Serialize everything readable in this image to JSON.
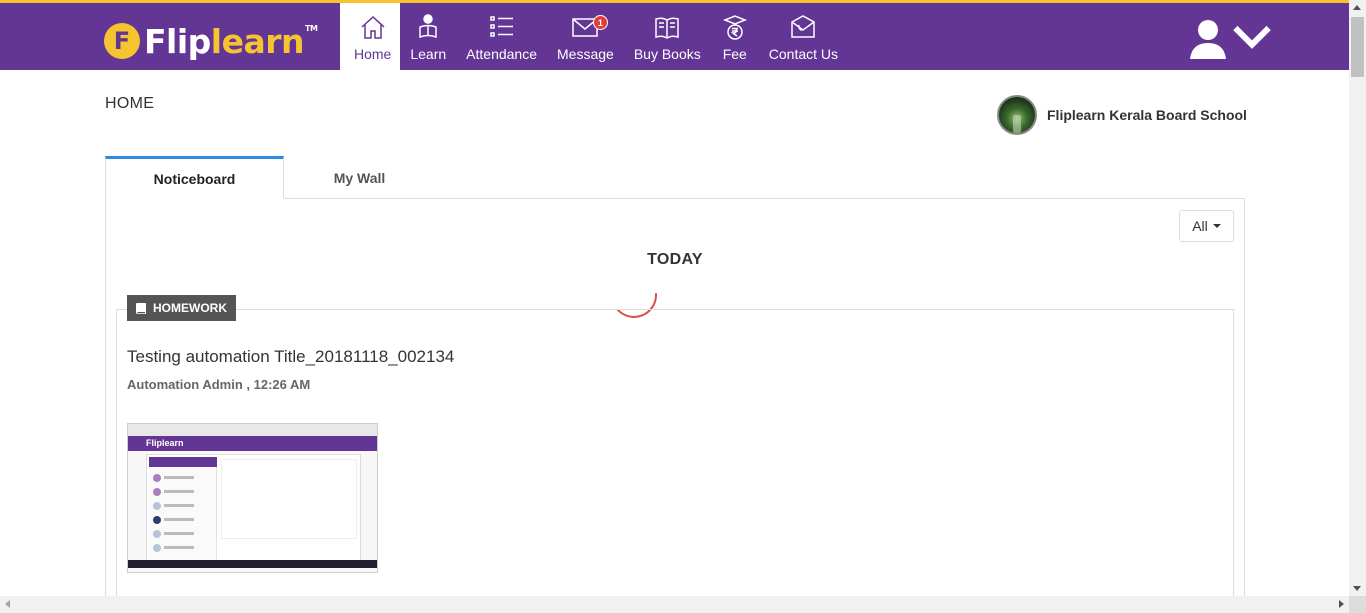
{
  "brand": {
    "logo_letter": "F",
    "logo_white": "Flip",
    "logo_yellow": "learn",
    "logo_tm": "TM",
    "primary_color": "#633594",
    "accent_color": "#f6c431"
  },
  "nav": {
    "items": [
      {
        "label": "Home",
        "icon": "home-icon",
        "active": true
      },
      {
        "label": "Learn",
        "icon": "learn-icon"
      },
      {
        "label": "Attendance",
        "icon": "attendance-icon"
      },
      {
        "label": "Message",
        "icon": "message-icon",
        "badge": "1"
      },
      {
        "label": "Buy Books",
        "icon": "books-icon"
      },
      {
        "label": "Fee",
        "icon": "fee-icon"
      },
      {
        "label": "Contact Us",
        "icon": "contact-icon"
      }
    ]
  },
  "header": {
    "page_title": "HOME",
    "school_name": "Fliplearn Kerala Board School"
  },
  "tabs": [
    {
      "label": "Noticeboard",
      "active": true
    },
    {
      "label": "My Wall"
    }
  ],
  "filter": {
    "selected": "All"
  },
  "feed": {
    "section_label": "TODAY",
    "post": {
      "tag": "HOMEWORK",
      "title": "Testing automation Title_20181118_002134",
      "meta": "Automation Admin , 12:26 AM",
      "attachment_logo": "Fliplearn"
    }
  }
}
